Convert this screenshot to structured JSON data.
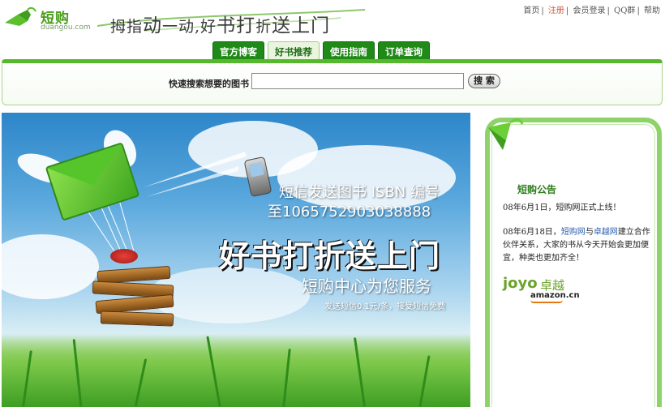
{
  "header": {
    "logo_cn": "短购",
    "logo_en": "duangou.com",
    "slogan": {
      "part1": "拇指",
      "part2": "动",
      "part3": "一动,好",
      "part4": "书",
      "part5": "打",
      "part6": "折",
      "part7": "送上门"
    },
    "topnav": [
      {
        "label": "首页"
      },
      {
        "label": "注册"
      },
      {
        "label": "会员登录"
      },
      {
        "label": "QQ群"
      },
      {
        "label": "帮助"
      }
    ],
    "topnav_sep": "|"
  },
  "tabs": [
    {
      "label": "官方博客"
    },
    {
      "label": "好书推荐"
    },
    {
      "label": "使用指南"
    },
    {
      "label": "订单查询"
    }
  ],
  "search": {
    "label": "快速搜索想要的图书",
    "value": "",
    "placeholder": "",
    "button_label": "搜 索"
  },
  "banner": {
    "line1": "短信发送图书 ISBN 编号",
    "line2": "至1065752903038888",
    "headline": "好书打折送上门",
    "sub": "短购中心为您服务",
    "note": "发送短信0.1元/条，接受短信免费"
  },
  "sidebar": {
    "title": "短购公告",
    "notice1": "08年6月1日，短购网正式上线！",
    "notice2_prefix": "08年6月18日，",
    "notice2_link1": "短购网",
    "notice2_mid": "与",
    "notice2_link2": "卓越网",
    "notice2_rest": "建立合作伙伴关系，大家的书从今天开始会更加便宜，种类也更加齐全！",
    "partner_word": "joyo",
    "partner_cn": "卓越",
    "partner_amazon": "amazon.cn"
  },
  "colors": {
    "brand_green": "#1f8a17",
    "accent_red": "#d05a3a",
    "link_blue": "#2a5fb0"
  }
}
